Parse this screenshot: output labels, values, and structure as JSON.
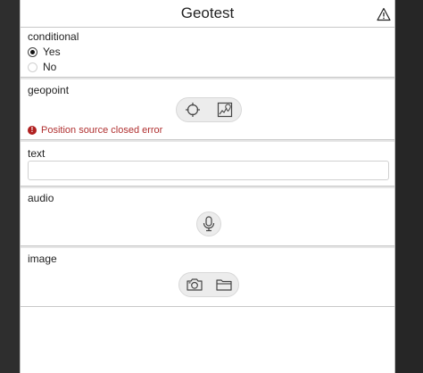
{
  "header": {
    "title": "Geotest",
    "warning_icon": "warning-triangle-icon"
  },
  "conditional": {
    "label": "conditional",
    "options": [
      {
        "label": "Yes",
        "selected": true
      },
      {
        "label": "No",
        "selected": false
      }
    ]
  },
  "geopoint": {
    "label": "geopoint",
    "buttons": [
      "crosshair-icon",
      "map-pin-icon"
    ],
    "error": "Position source closed error",
    "error_color": "#b03030"
  },
  "text": {
    "label": "text",
    "value": ""
  },
  "audio": {
    "label": "audio",
    "button": "microphone-icon"
  },
  "image": {
    "label": "image",
    "buttons": [
      "camera-icon",
      "folder-icon"
    ]
  }
}
